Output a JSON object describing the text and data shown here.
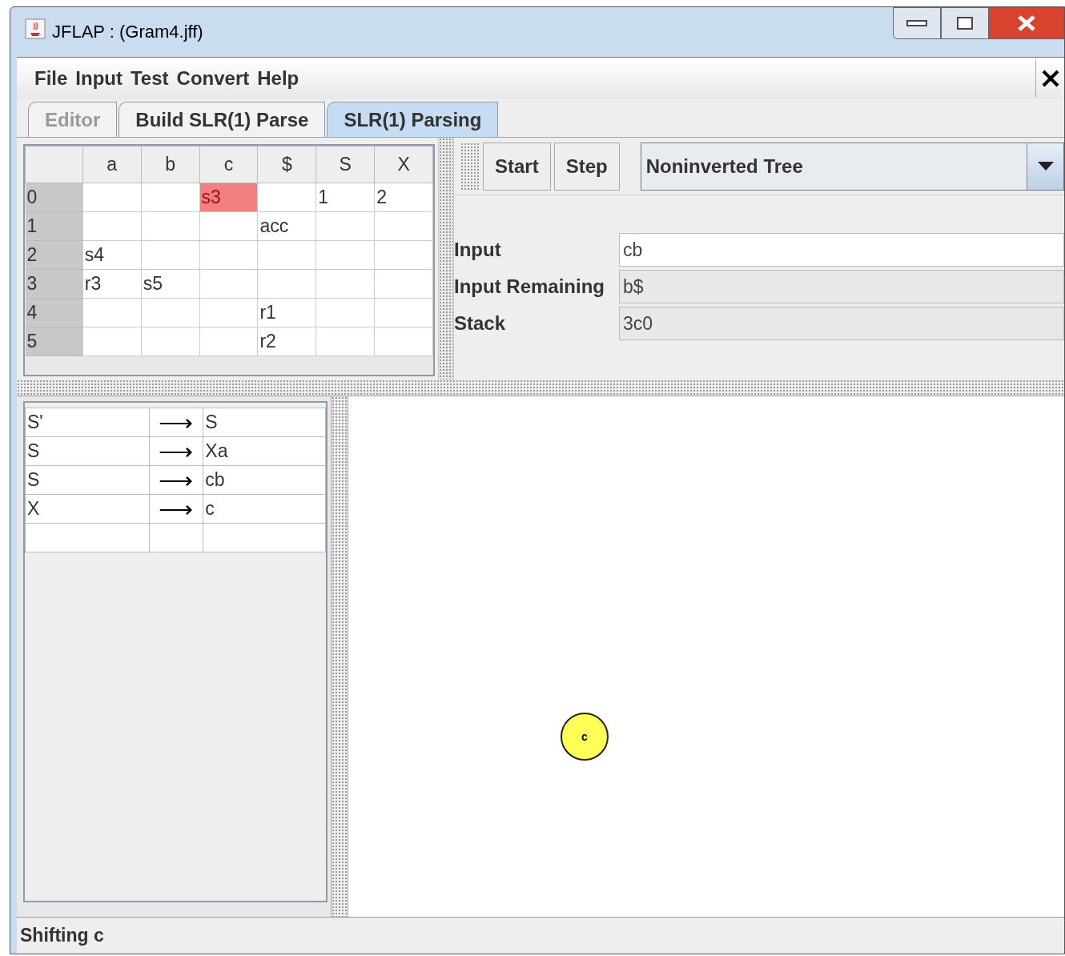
{
  "window": {
    "title": "JFLAP : (Gram4.jff)"
  },
  "menu": [
    "File",
    "Input",
    "Test",
    "Convert",
    "Help"
  ],
  "tabs": [
    {
      "label": "Editor",
      "selected": false,
      "disabled": true
    },
    {
      "label": "Build SLR(1) Parse",
      "selected": false,
      "disabled": false
    },
    {
      "label": "SLR(1) Parsing",
      "selected": true,
      "disabled": false
    }
  ],
  "parse_table": {
    "columns": [
      "a",
      "b",
      "c",
      "$",
      "S",
      "X"
    ],
    "rows": [
      {
        "state": "0",
        "cells": [
          {
            "text": ""
          },
          {
            "text": ""
          },
          {
            "text": "s3",
            "highlighted": true
          },
          {
            "text": ""
          },
          {
            "text": "1"
          },
          {
            "text": "2"
          }
        ]
      },
      {
        "state": "1",
        "cells": [
          {
            "text": ""
          },
          {
            "text": ""
          },
          {
            "text": ""
          },
          {
            "text": "acc"
          },
          {
            "text": ""
          },
          {
            "text": ""
          }
        ]
      },
      {
        "state": "2",
        "cells": [
          {
            "text": "s4"
          },
          {
            "text": ""
          },
          {
            "text": ""
          },
          {
            "text": ""
          },
          {
            "text": ""
          },
          {
            "text": ""
          }
        ]
      },
      {
        "state": "3",
        "cells": [
          {
            "text": "r3"
          },
          {
            "text": "s5"
          },
          {
            "text": ""
          },
          {
            "text": ""
          },
          {
            "text": ""
          },
          {
            "text": ""
          }
        ]
      },
      {
        "state": "4",
        "cells": [
          {
            "text": ""
          },
          {
            "text": ""
          },
          {
            "text": ""
          },
          {
            "text": "r1"
          },
          {
            "text": ""
          },
          {
            "text": ""
          }
        ]
      },
      {
        "state": "5",
        "cells": [
          {
            "text": ""
          },
          {
            "text": ""
          },
          {
            "text": ""
          },
          {
            "text": "r2"
          },
          {
            "text": ""
          },
          {
            "text": ""
          }
        ]
      }
    ]
  },
  "toolbar": {
    "buttons": [
      "Start",
      "Step"
    ],
    "view_select": "Noninverted Tree"
  },
  "fields": [
    {
      "label": "Input",
      "value": "cb",
      "editable": true
    },
    {
      "label": "Input Remaining",
      "value": "b$",
      "editable": false
    },
    {
      "label": "Stack",
      "value": "3c0",
      "editable": false
    }
  ],
  "grammar": [
    {
      "lhs": "S'",
      "arrow": "⟶",
      "rhs": "S"
    },
    {
      "lhs": "S",
      "arrow": "⟶",
      "rhs": "Xa"
    },
    {
      "lhs": "S",
      "arrow": "⟶",
      "rhs": "cb"
    },
    {
      "lhs": "X",
      "arrow": "⟶",
      "rhs": "c"
    }
  ],
  "tree": {
    "nodes": [
      {
        "label": "c"
      }
    ]
  },
  "status_bar": "Shifting c"
}
